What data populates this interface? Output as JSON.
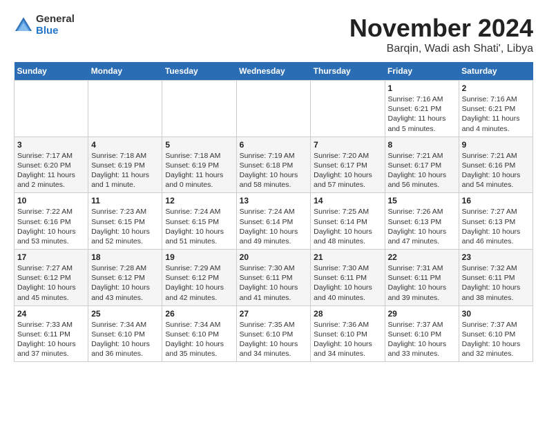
{
  "header": {
    "logo_general": "General",
    "logo_blue": "Blue",
    "month_title": "November 2024",
    "subtitle": "Barqin, Wadi ash Shati', Libya"
  },
  "weekdays": [
    "Sunday",
    "Monday",
    "Tuesday",
    "Wednesday",
    "Thursday",
    "Friday",
    "Saturday"
  ],
  "weeks": [
    [
      {
        "day": "",
        "info": ""
      },
      {
        "day": "",
        "info": ""
      },
      {
        "day": "",
        "info": ""
      },
      {
        "day": "",
        "info": ""
      },
      {
        "day": "",
        "info": ""
      },
      {
        "day": "1",
        "info": "Sunrise: 7:16 AM\nSunset: 6:21 PM\nDaylight: 11 hours and 5 minutes."
      },
      {
        "day": "2",
        "info": "Sunrise: 7:16 AM\nSunset: 6:21 PM\nDaylight: 11 hours and 4 minutes."
      }
    ],
    [
      {
        "day": "3",
        "info": "Sunrise: 7:17 AM\nSunset: 6:20 PM\nDaylight: 11 hours and 2 minutes."
      },
      {
        "day": "4",
        "info": "Sunrise: 7:18 AM\nSunset: 6:19 PM\nDaylight: 11 hours and 1 minute."
      },
      {
        "day": "5",
        "info": "Sunrise: 7:18 AM\nSunset: 6:19 PM\nDaylight: 11 hours and 0 minutes."
      },
      {
        "day": "6",
        "info": "Sunrise: 7:19 AM\nSunset: 6:18 PM\nDaylight: 10 hours and 58 minutes."
      },
      {
        "day": "7",
        "info": "Sunrise: 7:20 AM\nSunset: 6:17 PM\nDaylight: 10 hours and 57 minutes."
      },
      {
        "day": "8",
        "info": "Sunrise: 7:21 AM\nSunset: 6:17 PM\nDaylight: 10 hours and 56 minutes."
      },
      {
        "day": "9",
        "info": "Sunrise: 7:21 AM\nSunset: 6:16 PM\nDaylight: 10 hours and 54 minutes."
      }
    ],
    [
      {
        "day": "10",
        "info": "Sunrise: 7:22 AM\nSunset: 6:16 PM\nDaylight: 10 hours and 53 minutes."
      },
      {
        "day": "11",
        "info": "Sunrise: 7:23 AM\nSunset: 6:15 PM\nDaylight: 10 hours and 52 minutes."
      },
      {
        "day": "12",
        "info": "Sunrise: 7:24 AM\nSunset: 6:15 PM\nDaylight: 10 hours and 51 minutes."
      },
      {
        "day": "13",
        "info": "Sunrise: 7:24 AM\nSunset: 6:14 PM\nDaylight: 10 hours and 49 minutes."
      },
      {
        "day": "14",
        "info": "Sunrise: 7:25 AM\nSunset: 6:14 PM\nDaylight: 10 hours and 48 minutes."
      },
      {
        "day": "15",
        "info": "Sunrise: 7:26 AM\nSunset: 6:13 PM\nDaylight: 10 hours and 47 minutes."
      },
      {
        "day": "16",
        "info": "Sunrise: 7:27 AM\nSunset: 6:13 PM\nDaylight: 10 hours and 46 minutes."
      }
    ],
    [
      {
        "day": "17",
        "info": "Sunrise: 7:27 AM\nSunset: 6:12 PM\nDaylight: 10 hours and 45 minutes."
      },
      {
        "day": "18",
        "info": "Sunrise: 7:28 AM\nSunset: 6:12 PM\nDaylight: 10 hours and 43 minutes."
      },
      {
        "day": "19",
        "info": "Sunrise: 7:29 AM\nSunset: 6:12 PM\nDaylight: 10 hours and 42 minutes."
      },
      {
        "day": "20",
        "info": "Sunrise: 7:30 AM\nSunset: 6:11 PM\nDaylight: 10 hours and 41 minutes."
      },
      {
        "day": "21",
        "info": "Sunrise: 7:30 AM\nSunset: 6:11 PM\nDaylight: 10 hours and 40 minutes."
      },
      {
        "day": "22",
        "info": "Sunrise: 7:31 AM\nSunset: 6:11 PM\nDaylight: 10 hours and 39 minutes."
      },
      {
        "day": "23",
        "info": "Sunrise: 7:32 AM\nSunset: 6:11 PM\nDaylight: 10 hours and 38 minutes."
      }
    ],
    [
      {
        "day": "24",
        "info": "Sunrise: 7:33 AM\nSunset: 6:11 PM\nDaylight: 10 hours and 37 minutes."
      },
      {
        "day": "25",
        "info": "Sunrise: 7:34 AM\nSunset: 6:10 PM\nDaylight: 10 hours and 36 minutes."
      },
      {
        "day": "26",
        "info": "Sunrise: 7:34 AM\nSunset: 6:10 PM\nDaylight: 10 hours and 35 minutes."
      },
      {
        "day": "27",
        "info": "Sunrise: 7:35 AM\nSunset: 6:10 PM\nDaylight: 10 hours and 34 minutes."
      },
      {
        "day": "28",
        "info": "Sunrise: 7:36 AM\nSunset: 6:10 PM\nDaylight: 10 hours and 34 minutes."
      },
      {
        "day": "29",
        "info": "Sunrise: 7:37 AM\nSunset: 6:10 PM\nDaylight: 10 hours and 33 minutes."
      },
      {
        "day": "30",
        "info": "Sunrise: 7:37 AM\nSunset: 6:10 PM\nDaylight: 10 hours and 32 minutes."
      }
    ]
  ]
}
